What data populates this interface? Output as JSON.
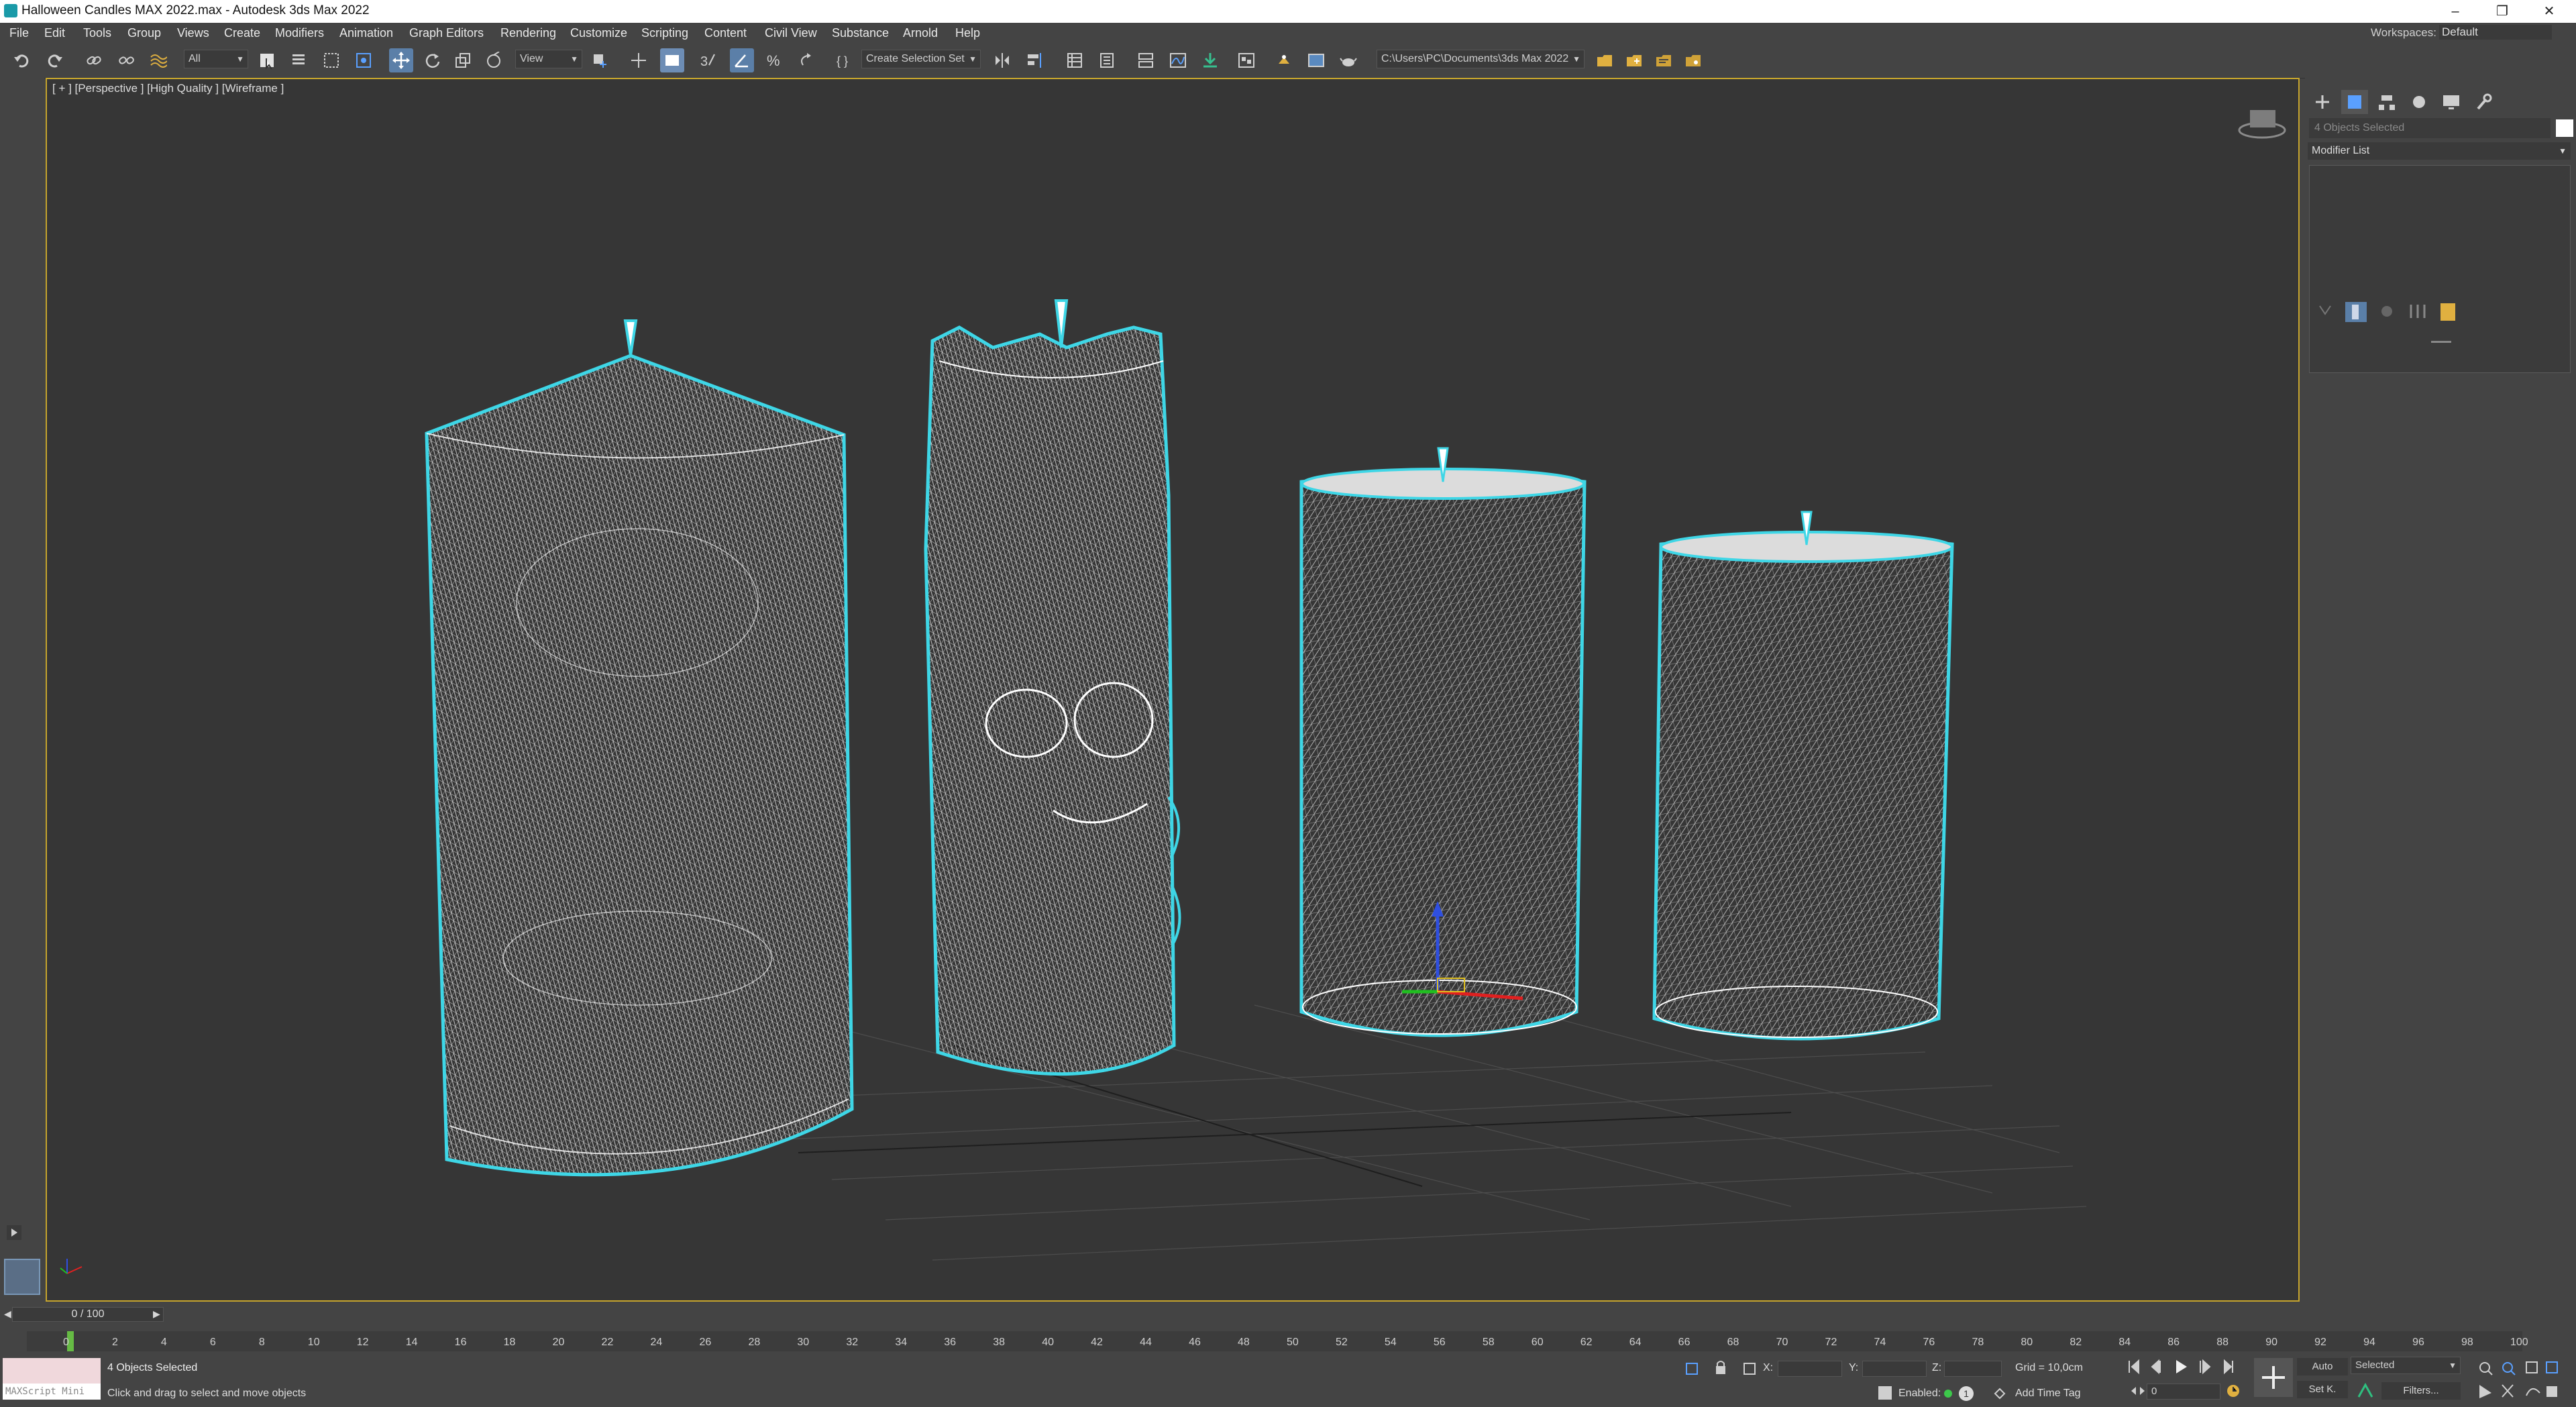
{
  "window": {
    "title": "Halloween Candles MAX 2022.max - Autodesk 3ds Max 2022",
    "minimize": "–",
    "maximize": "❐",
    "close": "✕"
  },
  "menu": {
    "items": [
      "File",
      "Edit",
      "Tools",
      "Group",
      "Views",
      "Create",
      "Modifiers",
      "Animation",
      "Graph Editors",
      "Rendering",
      "Customize",
      "Scripting",
      "Content",
      "Civil View",
      "Substance",
      "Arnold",
      "Help"
    ],
    "workspaces_label": "Workspaces:",
    "workspace_value": "Default"
  },
  "toolbar": {
    "filter_value": "All",
    "coord_value": "View",
    "selection_set": "Create Selection Set",
    "project_path": "C:\\Users\\PC\\Documents\\3ds Max 2022"
  },
  "viewport": {
    "label": "[ + ] [Perspective ] [High Quality ] [Wireframe ]",
    "wire_color": "#ffffff",
    "selection_color": "#3ed6e6"
  },
  "command_panel": {
    "selection_field": "4 Objects Selected",
    "modifier_list": "Modifier List"
  },
  "timeline": {
    "slider": "0 / 100",
    "ticks": [
      "0",
      "2",
      "4",
      "6",
      "8",
      "10",
      "12",
      "14",
      "16",
      "18",
      "20",
      "22",
      "24",
      "26",
      "28",
      "30",
      "32",
      "34",
      "36",
      "38",
      "40",
      "42",
      "44",
      "46",
      "48",
      "50",
      "52",
      "54",
      "56",
      "58",
      "60",
      "62",
      "64",
      "66",
      "68",
      "70",
      "72",
      "74",
      "76",
      "78",
      "80",
      "82",
      "84",
      "86",
      "88",
      "90",
      "92",
      "94",
      "96",
      "98",
      "100"
    ]
  },
  "status": {
    "objects": "4 Objects Selected",
    "prompt": "Click and drag to select and move objects",
    "maxscript": "MAXScript Mini",
    "x_label": "X:",
    "y_label": "Y:",
    "z_label": "Z:",
    "grid": "Grid = 10,0cm",
    "enabled": "Enabled:",
    "add_time_tag": "Add Time Tag",
    "auto": "Auto",
    "set_key": "Set K.",
    "selected": "Selected",
    "filters": "Filters...",
    "frame": "0"
  }
}
